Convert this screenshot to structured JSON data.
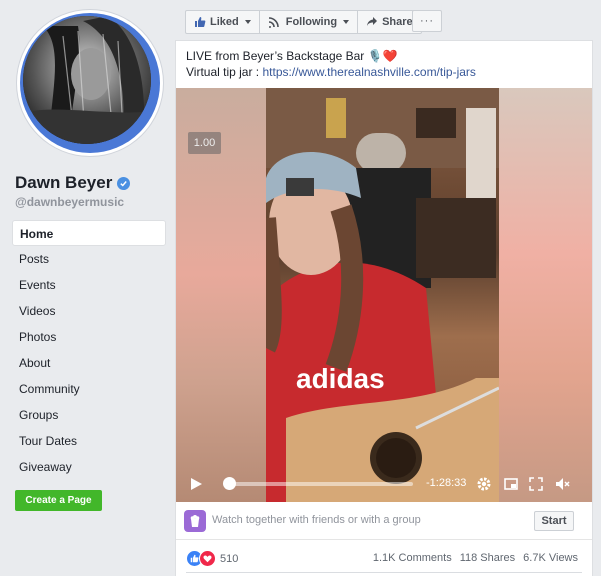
{
  "page": {
    "name": "Dawn Beyer",
    "handle": "@dawnbeyermusic",
    "verified": true
  },
  "nav": {
    "items": [
      {
        "label": "Home",
        "active": true
      },
      {
        "label": "Posts"
      },
      {
        "label": "Events"
      },
      {
        "label": "Videos"
      },
      {
        "label": "Photos"
      },
      {
        "label": "About"
      },
      {
        "label": "Community"
      },
      {
        "label": "Groups"
      },
      {
        "label": "Tour Dates"
      },
      {
        "label": "Giveaway"
      }
    ],
    "create_page_label": "Create a Page"
  },
  "actions": {
    "liked": "Liked",
    "following": "Following",
    "share": "Share",
    "more": "···"
  },
  "post": {
    "line1": "LIVE from Beyer’s Backstage Bar",
    "line2_prefix": "Virtual tip jar : ",
    "link": "https://www.therealnashville.com/tip-jars"
  },
  "video": {
    "playback_rate": "1.00",
    "time_remaining": "-1:28:33",
    "progress": 0.0
  },
  "watch_party": {
    "text": "Watch together with friends or with a group",
    "start_label": "Start"
  },
  "stats": {
    "reactions": "510",
    "comments": "1.1K Comments",
    "shares": "118 Shares",
    "views": "6.7K Views"
  },
  "colors": {
    "accent": "#4a78d6",
    "link": "#385898",
    "create_button": "#42b72a"
  }
}
